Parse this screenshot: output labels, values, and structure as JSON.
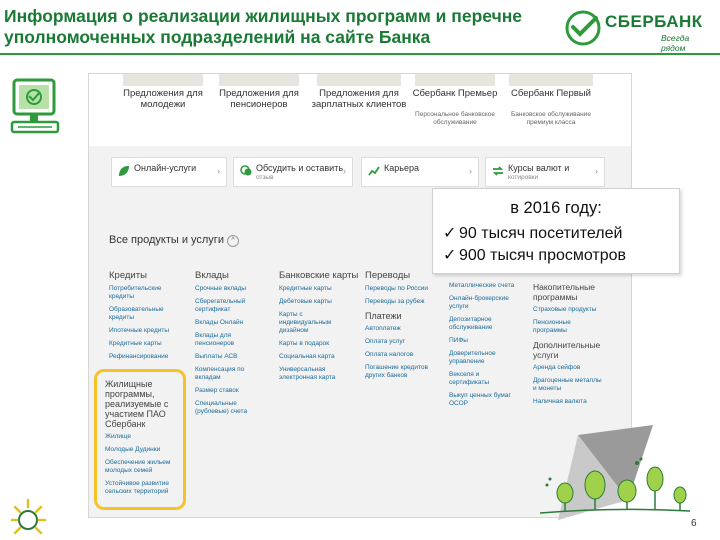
{
  "slide": {
    "title": "Информация о реализации жилищных программ и перечне уполномоченных подразделений на сайте Банка",
    "number": "6"
  },
  "logo": {
    "brand": "СБЕРБАНК",
    "slogan": "Всегда рядом",
    "color": "#1a7a35"
  },
  "site": {
    "promos": [
      {
        "label": "Предложения для молодежи",
        "sub": ""
      },
      {
        "label": "Предложения для пенсионеров",
        "sub": ""
      },
      {
        "label": "Предложения для зарплатных клиентов",
        "sub": ""
      },
      {
        "label": "Сбербанк Премьер",
        "sub": "Персональное банковское обслуживание"
      },
      {
        "label": "Сбербанк Первый",
        "sub": "Банковское обслуживание премиум класса"
      }
    ],
    "services": [
      {
        "label": "Онлайн-услуги",
        "sub": "",
        "icon": "leaf-icon"
      },
      {
        "label": "Обсудить и оставить",
        "sub": "отзыв",
        "icon": "chat-icon"
      },
      {
        "label": "Карьера",
        "sub": "",
        "icon": "chart-icon"
      },
      {
        "label": "Курсы валют и",
        "sub": "котировки",
        "icon": "currency-icon"
      }
    ],
    "all_products": "Все продукты и услуги",
    "columns": [
      {
        "head": "Кредиты",
        "items": [
          "Потребительские кредиты",
          "Образовательные кредиты",
          "Ипотечные кредиты",
          "Кредитные карты",
          "Рефинансирование"
        ],
        "sub_head": "",
        "sub_items": []
      },
      {
        "head": "Вклады",
        "items": [
          "Срочные вклады",
          "Сберегательный сертификат",
          "Вклады Онлайн",
          "Вклады для пенсионеров",
          "Выплаты АСВ",
          "Компенсация по вкладам",
          "Размер ставок",
          "Специальные (рублевые) счета"
        ],
        "sub_head": "",
        "sub_items": []
      },
      {
        "head": "Банковские карты",
        "items": [
          "Кредитные карты",
          "Дебетовые карты",
          "Карты с индивидуальным дизайном",
          "Карты в подарок",
          "Социальная карта",
          "Универсальная электронная карта"
        ],
        "sub_head": "",
        "sub_items": []
      },
      {
        "head": "Переводы",
        "items": [
          "Переводы по России",
          "Переводы за рубеж"
        ],
        "sub_head": "Платежи",
        "sub_items": [
          "Автоплатеж",
          "Оплата услуг",
          "Оплата налогов",
          "Погашение кредитов других банков"
        ]
      },
      {
        "head": "",
        "items": [
          "Металлические счета",
          "Онлайн-брокерские услуги",
          "Депозитарное обслуживание",
          "ПИФы",
          "Доверительное управление",
          "Векселя и сертификаты",
          "Выкуп ценных бумаг ОСОР"
        ],
        "sub_head": "",
        "sub_items": []
      },
      {
        "head": "Накопительные программы",
        "items": [
          "Страховые продукты",
          "Пенсионные программы"
        ],
        "sub_head": "Дополнительные услуги",
        "sub_items": [
          "Аренда сейфов",
          "Драгоценные металлы и монеты",
          "Наличная валюта"
        ]
      }
    ],
    "housing": {
      "head": "Жилищные программы, реализуемые с участием ПАО Сбербанк",
      "items": [
        "Жилище",
        "Молодые Дудинки",
        "Обеспечение жильем молодых семей",
        "Устойчивое развитие сельских территорий"
      ]
    }
  },
  "callout": {
    "title": "в 2016 году:",
    "rows": [
      "90 тысяч посетителей",
      "900 тысяч просмотров"
    ],
    "check": "✓"
  },
  "colors": {
    "highlight": "#f5c22a",
    "link": "#1a6b9a",
    "green": "#2e9a3c"
  }
}
